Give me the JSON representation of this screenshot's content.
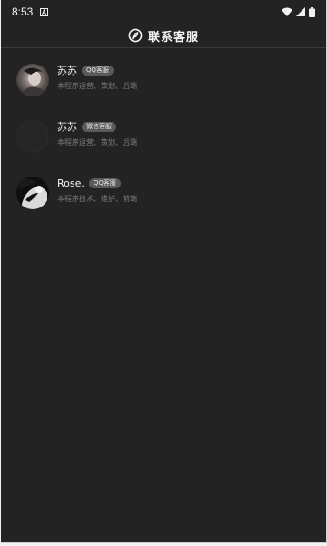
{
  "status_bar": {
    "time": "8:53",
    "icons": [
      "notification-a-icon",
      "wifi-icon",
      "signal-icon",
      "battery-icon"
    ]
  },
  "header": {
    "logo_icon": "leaf-logo-icon",
    "title": "联系客服"
  },
  "contacts": [
    {
      "name": "苏苏",
      "badge": "QQ客服",
      "description": "本程序运营、策划、后端"
    },
    {
      "name": "苏苏",
      "badge": "微信客服",
      "description": "本程序运营、策划、后端"
    },
    {
      "name": "Rose.",
      "badge": "QQ客服",
      "description": "本程序技术、维护、前端"
    }
  ],
  "colors": {
    "background": "#232323",
    "badge": "#5a5a5a",
    "description": "#7c7c7c"
  }
}
